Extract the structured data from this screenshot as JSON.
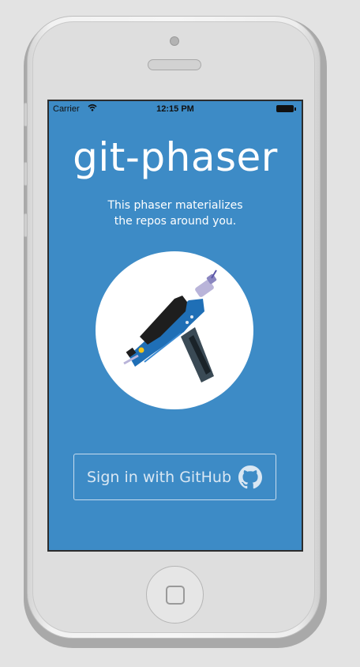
{
  "status_bar": {
    "carrier": "Carrier",
    "time": "12:15 PM",
    "wifi_icon": "wifi-icon",
    "battery_icon": "battery-icon"
  },
  "app": {
    "title": "git-phaser",
    "tagline_line1": "This phaser materializes",
    "tagline_line2": "the repos around you.",
    "logo_icon": "phaser-icon",
    "sign_in_label": "Sign in with GitHub",
    "sign_in_icon": "github-icon"
  },
  "colors": {
    "screen_background": "#3d8bc6",
    "text": "#ffffff",
    "button_border": "#c7dcee",
    "phaser_blue": "#1f6fb6",
    "phaser_black": "#1e1e1e",
    "phaser_grip": "#3a4a55"
  }
}
